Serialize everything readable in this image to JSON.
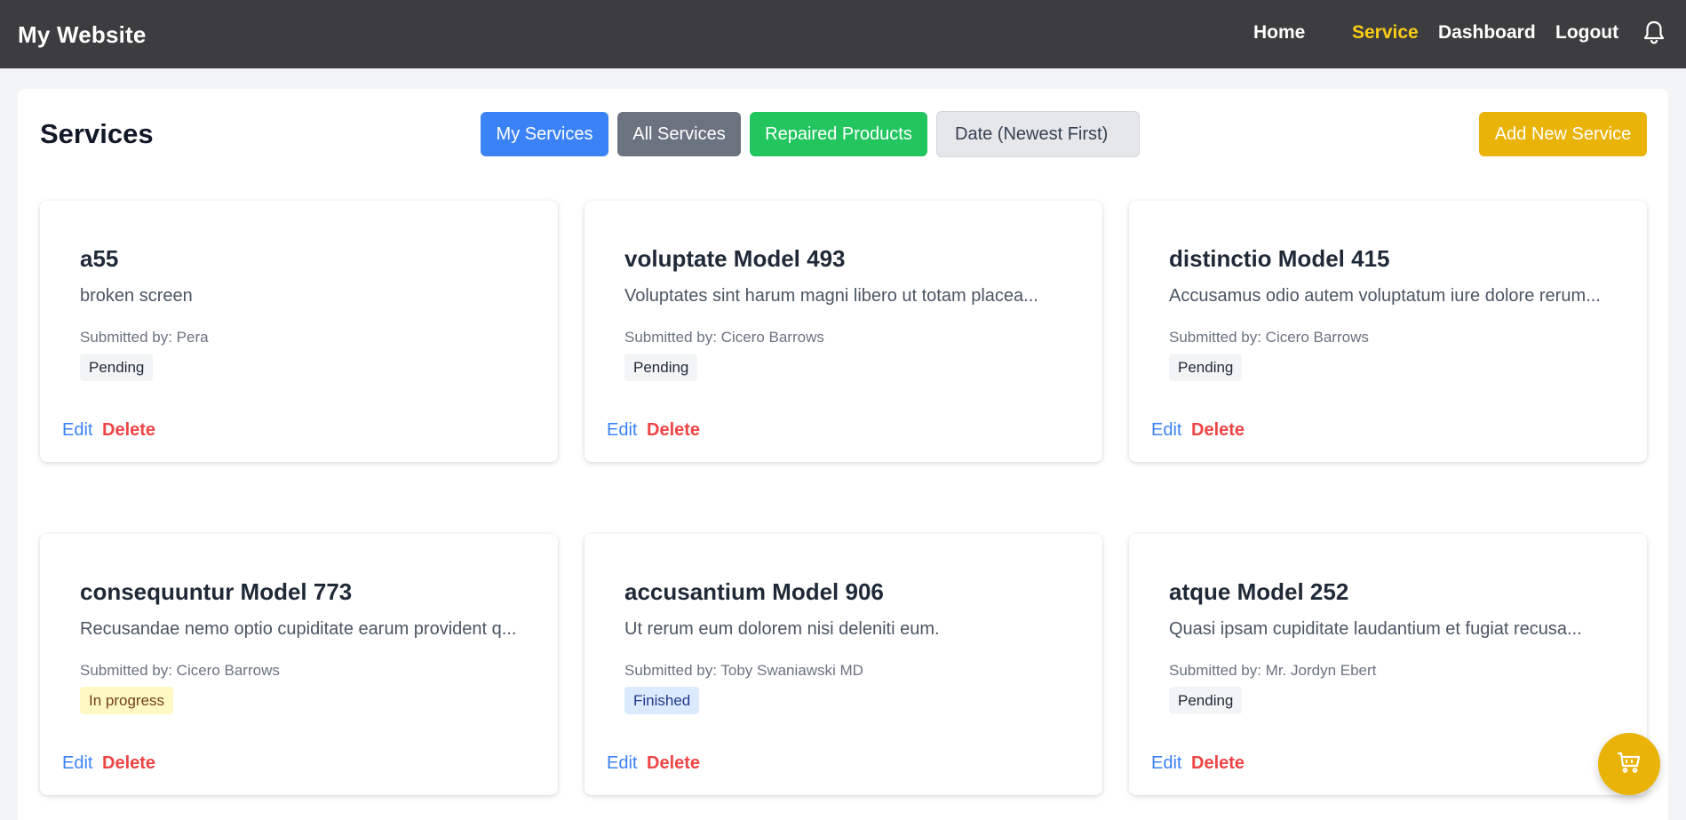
{
  "navbar": {
    "brand": "My Website",
    "links": [
      {
        "label": "Home"
      },
      {
        "label": "Service"
      },
      {
        "label": "Dashboard"
      },
      {
        "label": "Logout"
      }
    ],
    "active_color": "#facc15",
    "background": "#3d3d3f"
  },
  "page": {
    "title": "Services",
    "buttons": {
      "my_services": "My Services",
      "all_services": "All Services",
      "repaired_products": "Repaired Products",
      "add_new": "Add New Service"
    },
    "sort_select": "Date (Newest First)"
  },
  "cards": [
    {
      "title": "a55",
      "description": "broken screen",
      "submitted": "Submitted by: Pera",
      "status": "Pending",
      "edit": "Edit",
      "delete": "Delete"
    },
    {
      "title": "voluptate Model 493",
      "description": "Voluptates sint harum magni libero ut totam placea...",
      "submitted": "Submitted by: Cicero Barrows",
      "status": "Pending",
      "edit": "Edit",
      "delete": "Delete"
    },
    {
      "title": "distinctio Model 415",
      "description": "Accusamus odio autem voluptatum iure dolore rerum...",
      "submitted": "Submitted by: Cicero Barrows",
      "status": "Pending",
      "edit": "Edit",
      "delete": "Delete"
    },
    {
      "title": "consequuntur Model 773",
      "description": "Recusandae nemo optio cupiditate earum provident q...",
      "submitted": "Submitted by: Cicero Barrows",
      "status": "In progress",
      "edit": "Edit",
      "delete": "Delete"
    },
    {
      "title": "accusantium Model 906",
      "description": "Ut rerum eum dolorem nisi deleniti eum.",
      "submitted": "Submitted by: Toby Swaniawski MD",
      "status": "Finished",
      "edit": "Edit",
      "delete": "Delete"
    },
    {
      "title": "atque Model 252",
      "description": "Quasi ipsam cupiditate laudantium et fugiat recusa...",
      "submitted": "Submitted by: Mr. Jordyn Ebert",
      "status": "Pending",
      "edit": "Edit",
      "delete": "Delete"
    }
  ],
  "icons": {
    "bell": "bell-icon",
    "cart": "cart-icon"
  },
  "colors": {
    "primary_blue": "#3b82f6",
    "gray": "#6b7280",
    "green": "#22c55e",
    "yellow": "#eab308",
    "danger": "#ef4444"
  }
}
